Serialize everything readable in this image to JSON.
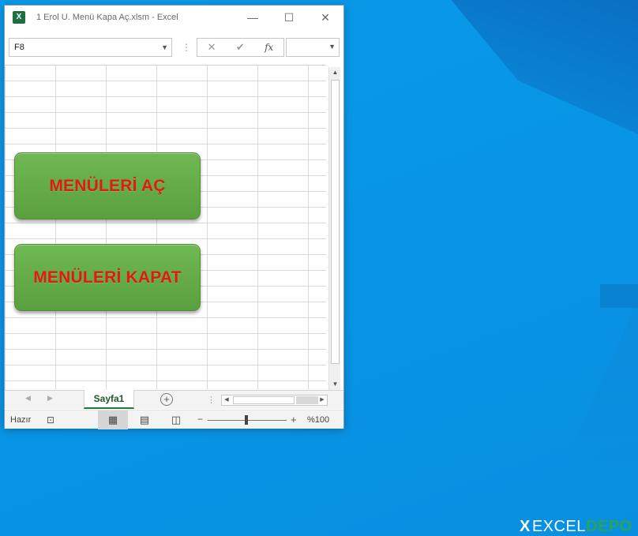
{
  "window": {
    "icon_letter": "X",
    "title": "1   Erol U. Menü Kapa Aç.xlsm  -  Excel",
    "controls": {
      "minimize": "—",
      "maximize": "☐",
      "close": "✕"
    }
  },
  "formula_bar": {
    "name_box_value": "F8",
    "cancel_symbol": "✕",
    "enter_symbol": "✔",
    "fx_symbol": "fx",
    "formula_value": ""
  },
  "buttons": {
    "open_menus": "MENÜLERİ AÇ",
    "close_menus": "MENÜLERİ KAPAT"
  },
  "sheet_tabs": {
    "active_tab": "Sayfa1",
    "add_symbol": "+"
  },
  "status_bar": {
    "status": "Hazır",
    "zoom_minus": "−",
    "zoom_plus": "+",
    "zoom_level": "%100"
  },
  "watermark": {
    "part1": "X",
    "part2": "EXCEL",
    "part3": "DEPO"
  },
  "colors": {
    "button_green": "#66ad4a",
    "button_text_red": "#e01b0f",
    "excel_green": "#1d6f42",
    "desktop_blue": "#0a9ae8"
  }
}
